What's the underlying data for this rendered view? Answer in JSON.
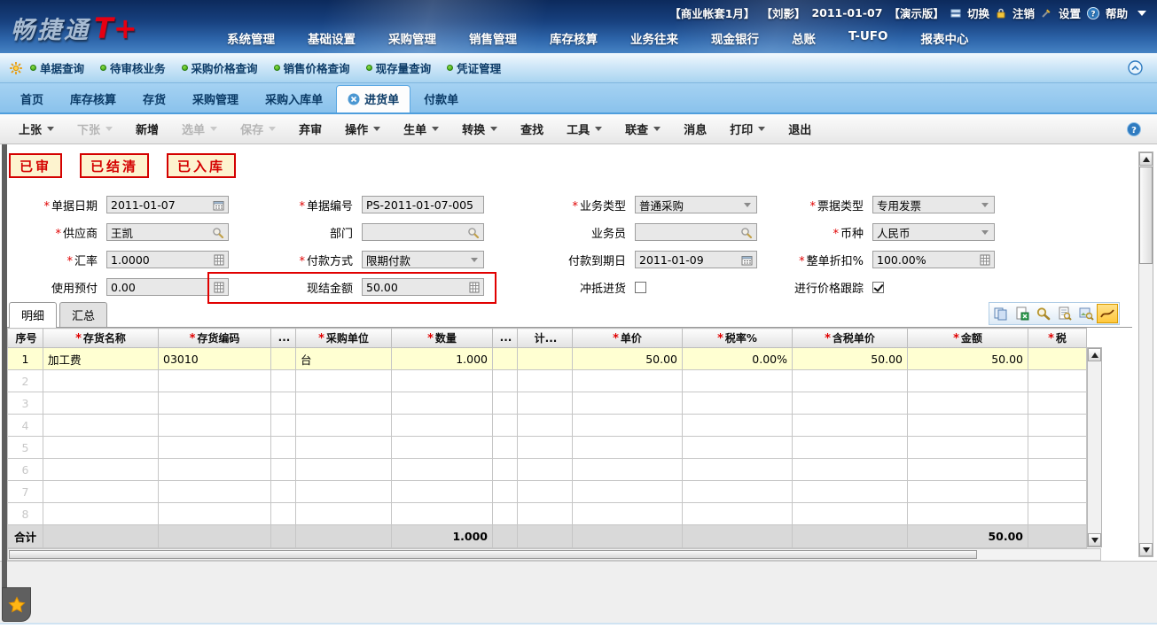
{
  "header": {
    "logo": {
      "brand": "畅捷通",
      "product": "T+"
    },
    "info": {
      "account_set": "【商业帐套1月】",
      "user": "【刘影】",
      "date": "2011-01-07",
      "edition": "【演示版】",
      "switch_label": "切换",
      "logout_label": "注销",
      "settings_label": "设置",
      "help_label": "帮助"
    },
    "nav": [
      "系统管理",
      "基础设置",
      "采购管理",
      "销售管理",
      "库存核算",
      "业务往来",
      "现金银行",
      "总账",
      "T-UFO",
      "报表中心"
    ]
  },
  "quickbar": {
    "items": [
      "单据查询",
      "待审核业务",
      "采购价格查询",
      "销售价格查询",
      "现存量查询",
      "凭证管理"
    ]
  },
  "tabbar": {
    "tabs": [
      {
        "label": "首页",
        "active": false
      },
      {
        "label": "库存核算",
        "active": false
      },
      {
        "label": "存货",
        "active": false
      },
      {
        "label": "采购管理",
        "active": false
      },
      {
        "label": "采购入库单",
        "active": false
      },
      {
        "label": "进货单",
        "active": true
      },
      {
        "label": "付款单",
        "active": false
      }
    ]
  },
  "toolbar": {
    "items": [
      {
        "label": "上张",
        "dropdown": true,
        "enabled": true
      },
      {
        "label": "下张",
        "dropdown": true,
        "enabled": false
      },
      {
        "label": "新增",
        "dropdown": false,
        "enabled": true
      },
      {
        "label": "选单",
        "dropdown": true,
        "enabled": false
      },
      {
        "label": "保存",
        "dropdown": true,
        "enabled": false
      },
      {
        "label": "弃审",
        "dropdown": false,
        "enabled": true
      },
      {
        "label": "操作",
        "dropdown": true,
        "enabled": true
      },
      {
        "label": "生单",
        "dropdown": true,
        "enabled": true
      },
      {
        "label": "转换",
        "dropdown": true,
        "enabled": true
      },
      {
        "label": "查找",
        "dropdown": false,
        "enabled": true
      },
      {
        "label": "工具",
        "dropdown": true,
        "enabled": true
      },
      {
        "label": "联查",
        "dropdown": true,
        "enabled": true
      },
      {
        "label": "消息",
        "dropdown": false,
        "enabled": true
      },
      {
        "label": "打印",
        "dropdown": true,
        "enabled": true
      },
      {
        "label": "退出",
        "dropdown": false,
        "enabled": true
      }
    ]
  },
  "stamps": [
    "已审",
    "已结清",
    "已入库"
  ],
  "form": {
    "doc_date": {
      "star": "*",
      "label": "单据日期",
      "value": "2011-01-07"
    },
    "doc_no": {
      "star": "*",
      "label": "单据编号",
      "value": "PS-2011-01-07-005"
    },
    "biz_type": {
      "star": "*",
      "label": "业务类型",
      "value": "普通采购"
    },
    "invoice_type": {
      "star": "*",
      "label": "票据类型",
      "value": "专用发票"
    },
    "supplier": {
      "star": "*",
      "label": "供应商",
      "value": "王凯"
    },
    "department": {
      "star": "",
      "label": "部门",
      "value": ""
    },
    "salesman": {
      "star": "",
      "label": "业务员",
      "value": ""
    },
    "currency": {
      "star": "*",
      "label": "币种",
      "value": "人民币"
    },
    "exchange_rate": {
      "star": "*",
      "label": "汇率",
      "value": "1.0000"
    },
    "pay_method": {
      "star": "*",
      "label": "付款方式",
      "value": "限期付款"
    },
    "due_date": {
      "star": "",
      "label": "付款到期日",
      "value": "2011-01-09"
    },
    "discount": {
      "star": "*",
      "label": "整单折扣%",
      "value": "100.00%"
    },
    "prepaid": {
      "star": "",
      "label": "使用预付",
      "value": "0.00"
    },
    "cash_settle": {
      "star": "",
      "label": "现结金额",
      "value": "50.00"
    },
    "offset_purchase": {
      "star": "",
      "label": "冲抵进货",
      "checked": false
    },
    "price_tracking": {
      "star": "",
      "label": "进行价格跟踪",
      "checked": true
    }
  },
  "detail": {
    "tabs": [
      {
        "label": "明细",
        "active": true
      },
      {
        "label": "汇总",
        "active": false
      }
    ],
    "icons": [
      "copy",
      "export-excel",
      "search",
      "preview",
      "locate",
      "chart"
    ]
  },
  "table": {
    "columns": [
      {
        "star": "",
        "label": "序号"
      },
      {
        "star": "*",
        "label": "存货名称"
      },
      {
        "star": "*",
        "label": "存货编码"
      },
      {
        "star": "",
        "label": "..."
      },
      {
        "star": "*",
        "label": "采购单位"
      },
      {
        "star": "*",
        "label": "数量"
      },
      {
        "star": "",
        "label": "..."
      },
      {
        "star": "",
        "label": "计..."
      },
      {
        "star": "*",
        "label": "单价"
      },
      {
        "star": "*",
        "label": "税率%"
      },
      {
        "star": "*",
        "label": "含税单价"
      },
      {
        "star": "*",
        "label": "金额"
      },
      {
        "star": "*",
        "label": "税"
      }
    ],
    "data_row": {
      "no": "1",
      "name": "加工费",
      "code": "03010",
      "unit": "台",
      "qty": "1.000",
      "price": "50.00",
      "tax_rate": "0.00%",
      "price_incl_tax": "50.00",
      "amount": "50.00"
    },
    "empty_rows": [
      "2",
      "3",
      "4",
      "5",
      "6",
      "7",
      "8"
    ],
    "total": {
      "label": "合计",
      "qty": "1.000",
      "amount": "50.00"
    }
  },
  "colors": {
    "accent_blue": "#2f7bc0",
    "stamp_red": "#d40000",
    "row_highlight": "#ffffd2",
    "header_navy": "#0c2a5c"
  }
}
